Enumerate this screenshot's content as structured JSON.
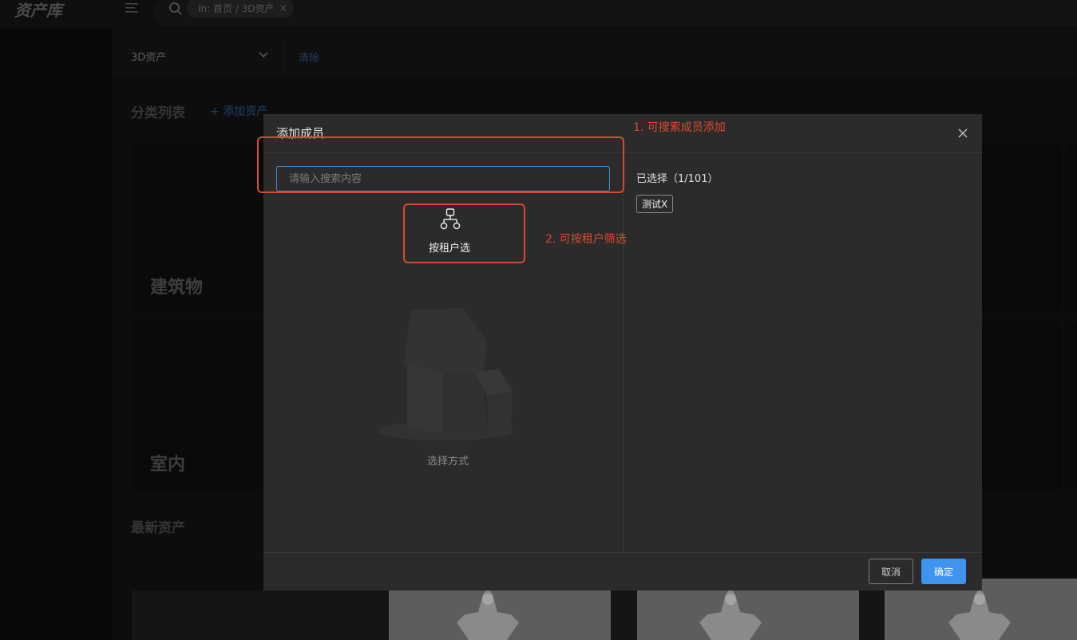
{
  "app": {
    "logo": "资产库",
    "breadcrumb_chip": "In: 首页 / 3D资产",
    "breadcrumb_close": "×"
  },
  "filter": {
    "asset_type": "3D资产",
    "clear_label": "清除"
  },
  "page": {
    "category_title": "分类列表",
    "add_asset": "+ 添加资产",
    "categories": [
      {
        "label": "建筑物"
      },
      {
        "label": "室内"
      }
    ],
    "latest_title": "最新资产"
  },
  "modal": {
    "title": "添加成员",
    "search_placeholder": "请输入搜索内容",
    "tenant_filter_label": "按租户选",
    "empty_text": "选择方式",
    "selected_count": "已选择（1/101）",
    "selected_members": [
      {
        "name": "测试X"
      }
    ],
    "cancel_label": "取消",
    "confirm_label": "确定"
  },
  "annotations": [
    {
      "text": "1. 可搜索成员添加"
    },
    {
      "text": "2. 可按租户筛选"
    }
  ],
  "colors": {
    "accent": "#3f94f0",
    "annotation": "#d84a2f",
    "modal_bg": "#2b2b2b"
  }
}
